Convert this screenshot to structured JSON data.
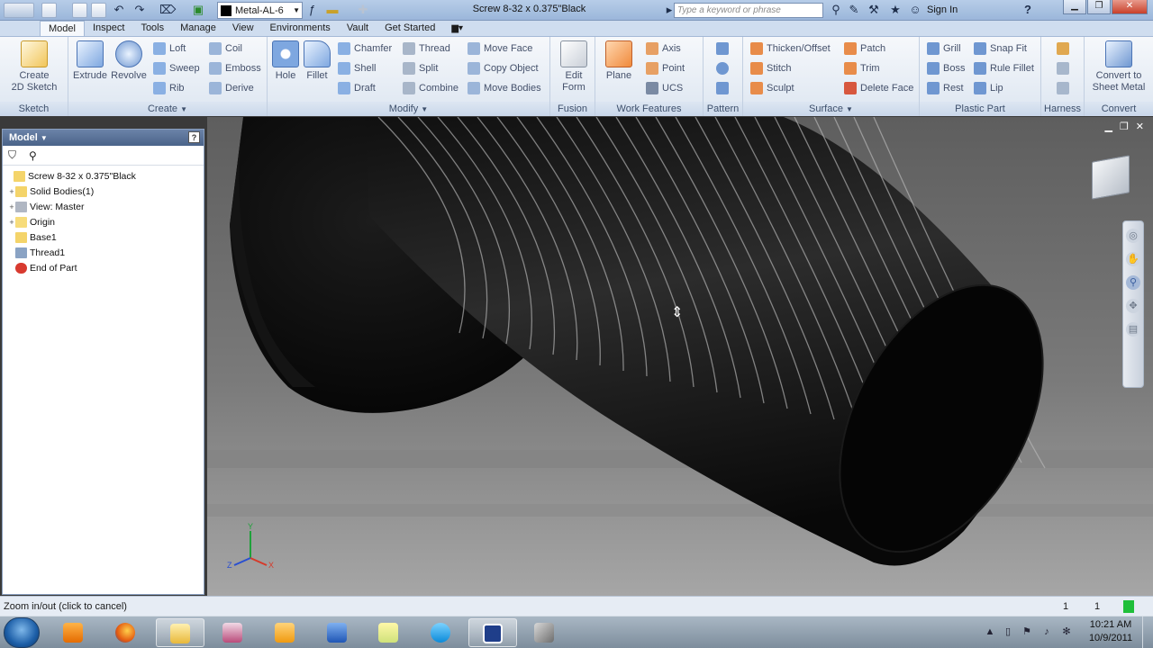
{
  "window": {
    "title": "Screw 8-32 x 0.375\"Black",
    "material": "Metal-AL-6",
    "search_placeholder": "Type a keyword or phrase",
    "sign_in": "Sign In"
  },
  "tabs": [
    "Model",
    "Inspect",
    "Tools",
    "Manage",
    "View",
    "Environments",
    "Vault",
    "Get Started"
  ],
  "active_tab": "Model",
  "ribbon": {
    "sketch": {
      "label": "Sketch",
      "create_2d": "Create\n2D Sketch"
    },
    "create": {
      "label": "Create",
      "extrude": "Extrude",
      "revolve": "Revolve",
      "loft": "Loft",
      "sweep": "Sweep",
      "rib": "Rib",
      "coil": "Coil",
      "emboss": "Emboss",
      "derive": "Derive"
    },
    "modify": {
      "label": "Modify",
      "hole": "Hole",
      "fillet": "Fillet",
      "chamfer": "Chamfer",
      "shell": "Shell",
      "draft": "Draft",
      "thread": "Thread",
      "split": "Split",
      "combine": "Combine",
      "move_face": "Move Face",
      "copy_object": "Copy Object",
      "move_bodies": "Move Bodies"
    },
    "fusion": {
      "label": "Fusion",
      "edit_form": "Edit\nForm"
    },
    "work_features": {
      "label": "Work Features",
      "plane": "Plane",
      "axis": "Axis",
      "point": "Point",
      "ucs": "UCS"
    },
    "pattern": {
      "label": "Pattern"
    },
    "surface": {
      "label": "Surface",
      "thicken": "Thicken/Offset",
      "stitch": "Stitch",
      "sculpt": "Sculpt",
      "patch": "Patch",
      "trim": "Trim",
      "delete_face": "Delete Face"
    },
    "plastic_part": {
      "label": "Plastic Part",
      "grill": "Grill",
      "boss": "Boss",
      "rest": "Rest",
      "snap_fit": "Snap Fit",
      "rule_fillet": "Rule Fillet",
      "lip": "Lip"
    },
    "harness": {
      "label": "Harness"
    },
    "convert": {
      "label": "Convert",
      "to_sheet_metal": "Convert to\nSheet Metal"
    }
  },
  "browser": {
    "title": "Model",
    "tree": [
      {
        "label": "Screw 8-32 x 0.375\"Black",
        "indent": 0,
        "expander": "",
        "icon": "part-icon",
        "color": "#f4d46a"
      },
      {
        "label": "Solid Bodies(1)",
        "indent": 1,
        "expander": "+",
        "icon": "folder-icon",
        "color": "#f4d46a"
      },
      {
        "label": "View: Master",
        "indent": 1,
        "expander": "+",
        "icon": "view-icon",
        "color": "#b0b7c3"
      },
      {
        "label": "Origin",
        "indent": 1,
        "expander": "+",
        "icon": "folder-icon",
        "color": "#f7dc7a"
      },
      {
        "label": "Base1",
        "indent": 1,
        "expander": "",
        "icon": "base-icon",
        "color": "#f4d46a"
      },
      {
        "label": "Thread1",
        "indent": 1,
        "expander": "",
        "icon": "thread-icon",
        "color": "#8aa3c4"
      },
      {
        "label": "End of Part",
        "indent": 1,
        "expander": "",
        "icon": "end-icon",
        "color": "#d83a2f"
      }
    ]
  },
  "viewport": {
    "axis_x": "X",
    "axis_y": "Y",
    "axis_z": "Z"
  },
  "status": {
    "text": "Zoom in/out (click to cancel)",
    "num1": "1",
    "num2": "1"
  },
  "taskbar": {
    "time": "10:21 AM",
    "date": "10/9/2011"
  }
}
